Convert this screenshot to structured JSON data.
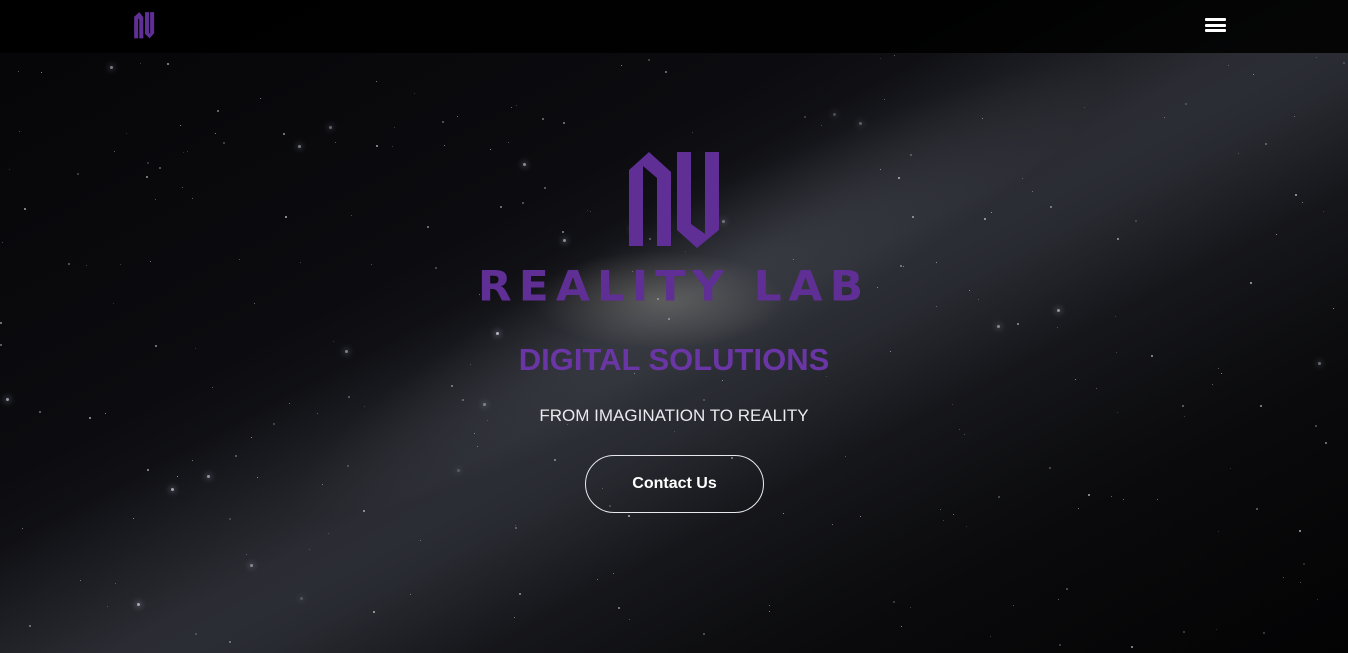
{
  "brand": {
    "logo_icon": "nu-monogram-logo-icon",
    "wordmark": "REALITY LAB",
    "accent_color": "#5f2f95"
  },
  "navbar": {
    "menu_icon": "hamburger-menu-icon"
  },
  "hero": {
    "tagline": "DIGITAL SOLUTIONS",
    "subtitle": "FROM IMAGINATION TO REALITY",
    "cta_label": "Contact Us"
  }
}
